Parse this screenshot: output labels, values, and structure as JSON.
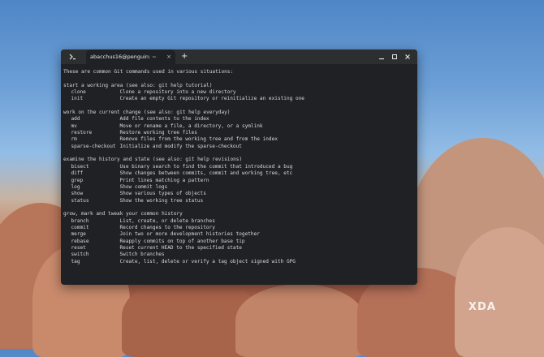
{
  "window": {
    "tab_title": "abacchus16@penguin: ~",
    "tab_close": "×",
    "new_tab": "+"
  },
  "icons": {
    "app": "terminal-icon",
    "minimize": "minimize-icon",
    "maximize": "maximize-icon",
    "close": "close-icon"
  },
  "terminal": {
    "intro": "These are common Git commands used in various situations:",
    "sections": [
      {
        "heading": "start a working area (see also: git help tutorial)",
        "commands": [
          {
            "name": "clone",
            "desc": "Clone a repository into a new directory"
          },
          {
            "name": "init",
            "desc": "Create an empty Git repository or reinitialize an existing one"
          }
        ]
      },
      {
        "heading": "work on the current change (see also: git help everyday)",
        "commands": [
          {
            "name": "add",
            "desc": "Add file contents to the index"
          },
          {
            "name": "mv",
            "desc": "Move or rename a file, a directory, or a symlink"
          },
          {
            "name": "restore",
            "desc": "Restore working tree files"
          },
          {
            "name": "rm",
            "desc": "Remove files from the working tree and from the index"
          },
          {
            "name": "sparse-checkout",
            "desc": "Initialize and modify the sparse-checkout"
          }
        ]
      },
      {
        "heading": "examine the history and state (see also: git help revisions)",
        "commands": [
          {
            "name": "bisect",
            "desc": "Use binary search to find the commit that introduced a bug"
          },
          {
            "name": "diff",
            "desc": "Show changes between commits, commit and working tree, etc"
          },
          {
            "name": "grep",
            "desc": "Print lines matching a pattern"
          },
          {
            "name": "log",
            "desc": "Show commit logs"
          },
          {
            "name": "show",
            "desc": "Show various types of objects"
          },
          {
            "name": "status",
            "desc": "Show the working tree status"
          }
        ]
      },
      {
        "heading": "grow, mark and tweak your common history",
        "commands": [
          {
            "name": "branch",
            "desc": "List, create, or delete branches"
          },
          {
            "name": "commit",
            "desc": "Record changes to the repository"
          },
          {
            "name": "merge",
            "desc": "Join two or more development histories together"
          },
          {
            "name": "rebase",
            "desc": "Reapply commits on top of another base tip"
          },
          {
            "name": "reset",
            "desc": "Reset current HEAD to the specified state"
          },
          {
            "name": "switch",
            "desc": "Switch branches"
          },
          {
            "name": "tag",
            "desc": "Create, list, delete or verify a tag object signed with GPG"
          }
        ]
      }
    ]
  },
  "watermark": "XDA"
}
